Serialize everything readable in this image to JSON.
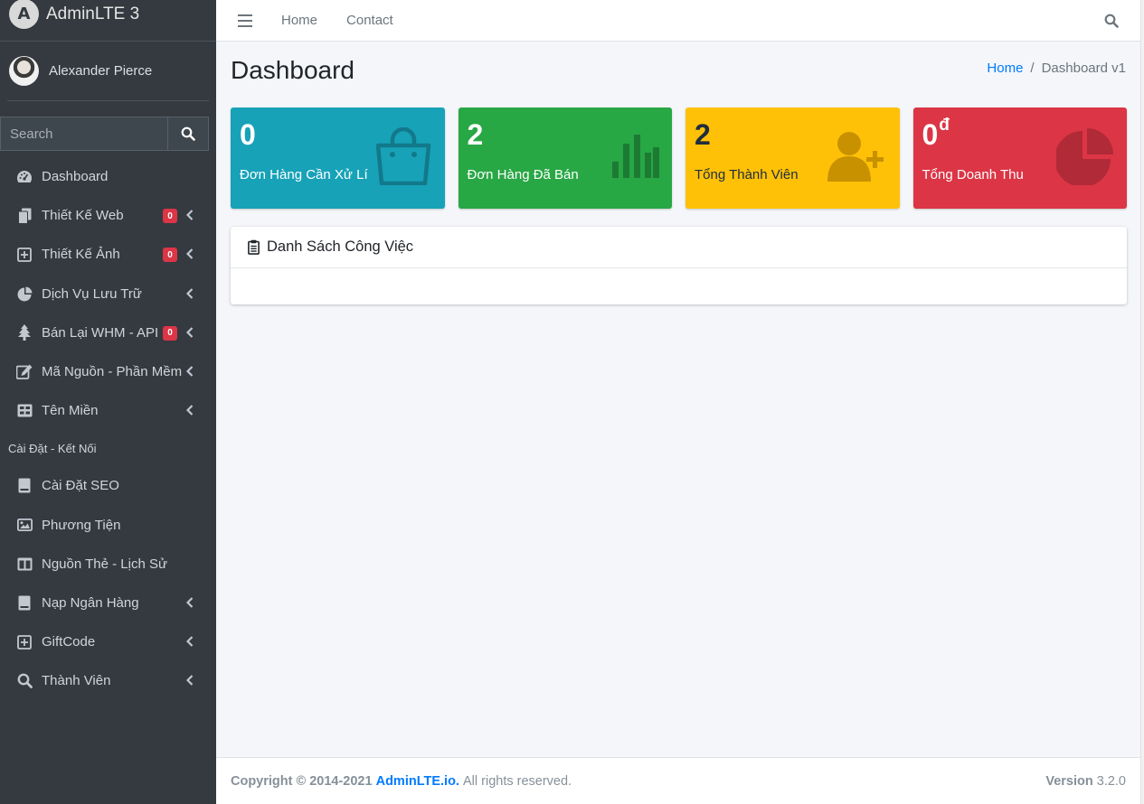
{
  "brand": {
    "name": "AdminLTE 3",
    "logo_letter": "A"
  },
  "user": {
    "name": "Alexander Pierce"
  },
  "sidebar_search": {
    "placeholder": "Search"
  },
  "nav": {
    "items": [
      {
        "label": "Dashboard",
        "icon": "tachometer-icon"
      },
      {
        "label": "Thiết Kế Web",
        "icon": "copy-icon",
        "badge": "0",
        "arrow": true
      },
      {
        "label": "Thiết Kế Ảnh",
        "icon": "plus-square-icon",
        "badge": "0",
        "arrow": true
      },
      {
        "label": "Dịch Vụ Lưu Trữ",
        "icon": "pie-chart-icon",
        "arrow": true
      },
      {
        "label": "Bán Lại WHM - API",
        "icon": "tree-icon",
        "badge": "0",
        "arrow": true
      },
      {
        "label": "Mã Nguồn - Phần Mềm",
        "icon": "edit-icon",
        "arrow": true
      },
      {
        "label": "Tên Miền",
        "icon": "th-large-icon",
        "arrow": true
      }
    ],
    "header": "Cài Đặt - Kết Nối",
    "items2": [
      {
        "label": "Cài Đặt SEO",
        "icon": "book-icon"
      },
      {
        "label": "Phương Tiện",
        "icon": "image-icon"
      },
      {
        "label": "Nguồn Thẻ - Lịch Sử",
        "icon": "columns-icon"
      },
      {
        "label": "Nạp Ngân Hàng",
        "icon": "book-icon",
        "arrow": true
      },
      {
        "label": "GiftCode",
        "icon": "plus-square-icon",
        "arrow": true
      },
      {
        "label": "Thành Viên",
        "icon": "search-icon",
        "arrow": true
      }
    ]
  },
  "topbar": {
    "home": "Home",
    "contact": "Contact"
  },
  "page": {
    "title": "Dashboard"
  },
  "breadcrumb": {
    "home": "Home",
    "separator": "/",
    "current": "Dashboard v1"
  },
  "stats": [
    {
      "value": "0",
      "label": "Đơn Hàng Cần Xử Lí",
      "color": "#17a2b8",
      "icon": "shopping-bag-icon"
    },
    {
      "value": "2",
      "label": "Đơn Hàng Đã Bán",
      "color": "#28a745",
      "icon": "bar-chart-icon"
    },
    {
      "value": "2",
      "label": "Tổng Thành Viên",
      "color": "#ffc107",
      "icon": "user-plus-icon"
    },
    {
      "value": "0",
      "unit": "đ",
      "label": "Tổng Doanh Thu",
      "color": "#dc3545",
      "icon": "pie-chart-icon"
    }
  ],
  "card": {
    "title": "Danh Sách Công Việc",
    "icon": "clipboard-icon"
  },
  "footer": {
    "copyright": "Copyright © 2014-2021",
    "link": "AdminLTE.io.",
    "rights": "All rights reserved.",
    "version_label": "Version",
    "version": "3.2.0"
  }
}
